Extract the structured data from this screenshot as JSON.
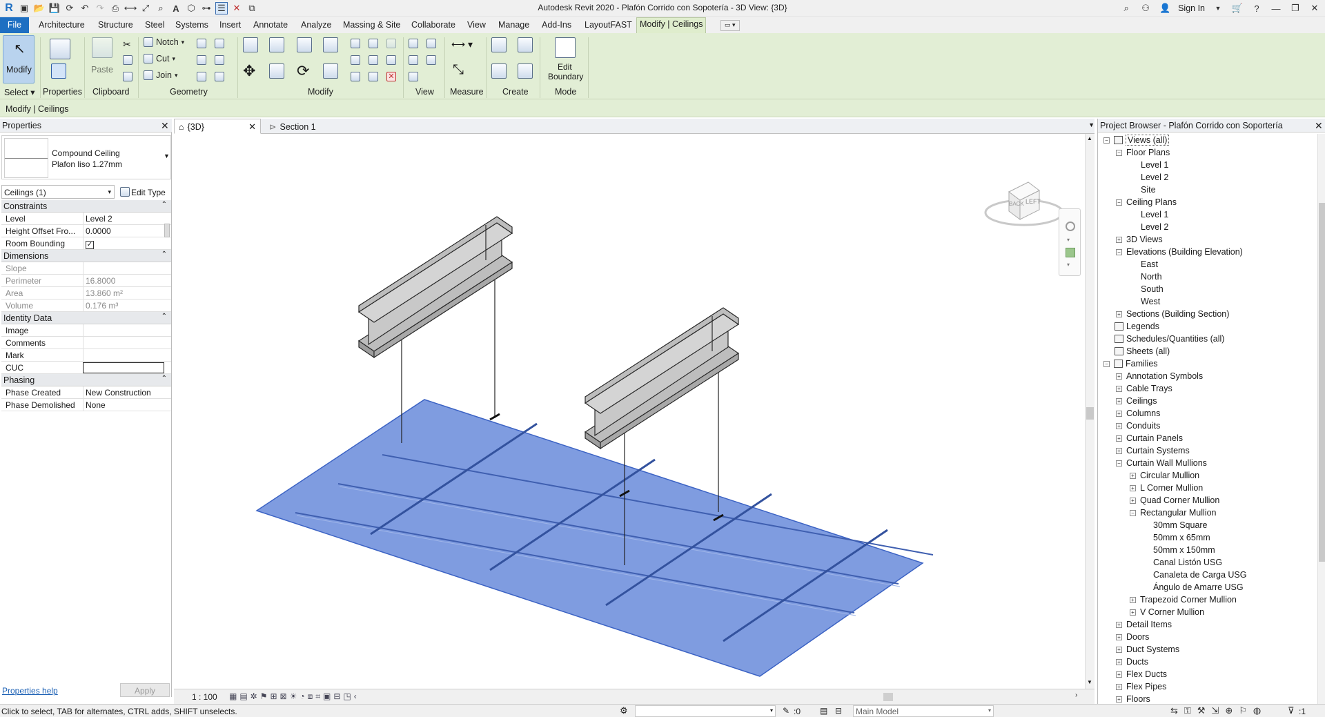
{
  "app": {
    "title": "Autodesk Revit 2020 - Plafón Corrido con Sopotería - 3D View: {3D}"
  },
  "titlebar": {
    "sign_in": "Sign In"
  },
  "menu": {
    "file": "File",
    "tabs": [
      "Architecture",
      "Structure",
      "Steel",
      "Systems",
      "Insert",
      "Annotate",
      "Analyze",
      "Massing & Site",
      "Collaborate",
      "View",
      "Manage",
      "Add-Ins",
      "LayoutFAST",
      "Modify | Ceilings"
    ]
  },
  "ribbon": {
    "modify": "Modify",
    "properties": "Properties",
    "paste": "Paste",
    "notch": "Notch",
    "cut": "Cut",
    "join": "Join",
    "edit_boundary_1": "Edit",
    "edit_boundary_2": "Boundary",
    "groups": {
      "select": "Select",
      "properties": "Properties",
      "clipboard": "Clipboard",
      "geometry": "Geometry",
      "modify": "Modify",
      "view": "View",
      "measure": "Measure",
      "create": "Create",
      "mode": "Mode"
    }
  },
  "context_bar": {
    "label": "Modify | Ceilings"
  },
  "properties": {
    "title": "Properties",
    "type_family": "Compound Ceiling",
    "type_name": "Plafon liso 1.27mm",
    "instance_filter": "Ceilings (1)",
    "edit_type": "Edit Type",
    "categories": {
      "constraints": "Constraints",
      "dimensions": "Dimensions",
      "identity": "Identity Data",
      "phasing": "Phasing"
    },
    "rows": {
      "level": {
        "k": "Level",
        "v": "Level 2"
      },
      "height_offset": {
        "k": "Height Offset Fro...",
        "v": "0.0000"
      },
      "room_bounding": {
        "k": "Room Bounding",
        "v": "checked"
      },
      "slope": {
        "k": "Slope",
        "v": ""
      },
      "perimeter": {
        "k": "Perimeter",
        "v": "16.8000"
      },
      "area": {
        "k": "Area",
        "v": "13.860 m²"
      },
      "volume": {
        "k": "Volume",
        "v": "0.176 m³"
      },
      "image": {
        "k": "Image",
        "v": ""
      },
      "comments": {
        "k": "Comments",
        "v": ""
      },
      "mark": {
        "k": "Mark",
        "v": ""
      },
      "cuc": {
        "k": "CUC",
        "v": ""
      },
      "phase_created": {
        "k": "Phase Created",
        "v": "New Construction"
      },
      "phase_demolished": {
        "k": "Phase Demolished",
        "v": "None"
      }
    },
    "help": "Properties help",
    "apply": "Apply"
  },
  "view_tabs": [
    {
      "label": "{3D}",
      "active": true
    },
    {
      "label": "Section 1",
      "active": false
    }
  ],
  "viewcube": {
    "left": "LEFT",
    "back": "BACK"
  },
  "view_control": {
    "scale": "1 : 100"
  },
  "browser": {
    "title": "Project Browser - Plafón Corrido con Soportería",
    "nodes": [
      {
        "label": "Views (all)",
        "depth": 0,
        "toggle": "-",
        "icon": true
      },
      {
        "label": "Floor Plans",
        "depth": 1,
        "toggle": "-"
      },
      {
        "label": "Level 1",
        "depth": 2
      },
      {
        "label": "Level 2",
        "depth": 2
      },
      {
        "label": "Site",
        "depth": 2
      },
      {
        "label": "Ceiling Plans",
        "depth": 1,
        "toggle": "-"
      },
      {
        "label": "Level 1",
        "depth": 2
      },
      {
        "label": "Level 2",
        "depth": 2
      },
      {
        "label": "3D Views",
        "depth": 1,
        "toggle": "+"
      },
      {
        "label": "Elevations (Building Elevation)",
        "depth": 1,
        "toggle": "-"
      },
      {
        "label": "East",
        "depth": 2
      },
      {
        "label": "North",
        "depth": 2
      },
      {
        "label": "South",
        "depth": 2
      },
      {
        "label": "West",
        "depth": 2
      },
      {
        "label": "Sections (Building Section)",
        "depth": 1,
        "toggle": "+"
      },
      {
        "label": "Legends",
        "depth": 0,
        "icon": true
      },
      {
        "label": "Schedules/Quantities (all)",
        "depth": 0,
        "icon": true
      },
      {
        "label": "Sheets (all)",
        "depth": 0,
        "icon": true
      },
      {
        "label": "Families",
        "depth": 0,
        "toggle": "-",
        "icon": true
      },
      {
        "label": "Annotation Symbols",
        "depth": 1,
        "toggle": "+"
      },
      {
        "label": "Cable Trays",
        "depth": 1,
        "toggle": "+"
      },
      {
        "label": "Ceilings",
        "depth": 1,
        "toggle": "+"
      },
      {
        "label": "Columns",
        "depth": 1,
        "toggle": "+"
      },
      {
        "label": "Conduits",
        "depth": 1,
        "toggle": "+"
      },
      {
        "label": "Curtain Panels",
        "depth": 1,
        "toggle": "+"
      },
      {
        "label": "Curtain Systems",
        "depth": 1,
        "toggle": "+"
      },
      {
        "label": "Curtain Wall Mullions",
        "depth": 1,
        "toggle": "-"
      },
      {
        "label": "Circular Mullion",
        "depth": 2,
        "toggle": "+"
      },
      {
        "label": "L Corner Mullion",
        "depth": 2,
        "toggle": "+"
      },
      {
        "label": "Quad Corner Mullion",
        "depth": 2,
        "toggle": "+"
      },
      {
        "label": "Rectangular Mullion",
        "depth": 2,
        "toggle": "-"
      },
      {
        "label": "30mm Square",
        "depth": 3
      },
      {
        "label": "50mm x 65mm",
        "depth": 3
      },
      {
        "label": "50mm x 150mm",
        "depth": 3
      },
      {
        "label": "Canal Listón USG",
        "depth": 3
      },
      {
        "label": "Canaleta de Carga USG",
        "depth": 3
      },
      {
        "label": "Ángulo de Amarre USG",
        "depth": 3
      },
      {
        "label": "Trapezoid Corner Mullion",
        "depth": 2,
        "toggle": "+"
      },
      {
        "label": "V Corner Mullion",
        "depth": 2,
        "toggle": "+"
      },
      {
        "label": "Detail Items",
        "depth": 1,
        "toggle": "+"
      },
      {
        "label": "Doors",
        "depth": 1,
        "toggle": "+"
      },
      {
        "label": "Duct Systems",
        "depth": 1,
        "toggle": "+"
      },
      {
        "label": "Ducts",
        "depth": 1,
        "toggle": "+"
      },
      {
        "label": "Flex Ducts",
        "depth": 1,
        "toggle": "+"
      },
      {
        "label": "Flex Pipes",
        "depth": 1,
        "toggle": "+"
      },
      {
        "label": "Floors",
        "depth": 1,
        "toggle": "+"
      }
    ]
  },
  "status": {
    "hint": "Click to select, TAB for alternates, CTRL adds, SHIFT unselects.",
    "count": ":0",
    "model": "Main Model",
    "filter_count": ":1"
  },
  "colors": {
    "ribbon": "#e2eed5",
    "file_tab": "#1e6fc2",
    "ceiling_fill": "#6f8fdc",
    "ceiling_edge": "#3c63c4",
    "beam": "#b7b7b7"
  }
}
